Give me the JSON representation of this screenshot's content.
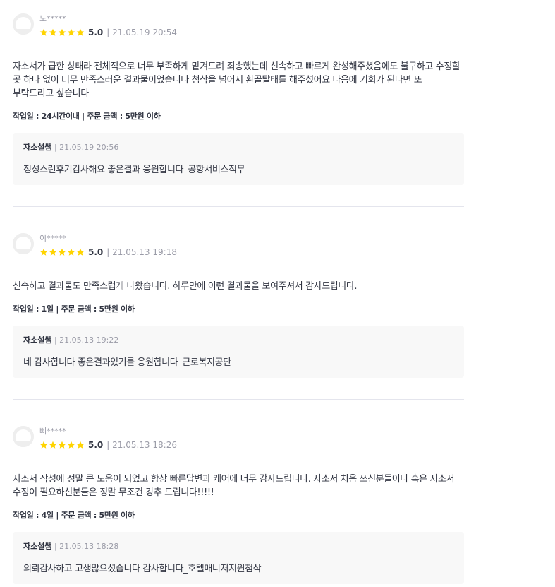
{
  "reviews": [
    {
      "nickname": "노*****",
      "score": "5.0",
      "date": "| 21.05.19 20:54",
      "content": "자소서가 급한 상태라 전체적으로 너무 부족하게 맡겨드려 죄송했는데 신속하고 빠르게 완성해주셨음에도 불구하고 수정할 곳 하나 없이 너무 만족스러운 결과물이었습니다 첨삭을 넘어서 환골탈태를 해주셨어요 다음에 기회가 된다면 또 부탁드리고 싶습니다",
      "meta": "작업일 : 24시간이내 | 주문 금액 : 5만원 이하",
      "reply": {
        "author": "자소설쌤",
        "date": " | 21.05.19 20:56",
        "text": "정성스런후기감사해요 좋은결과 응원합니다_공항서비스직무"
      }
    },
    {
      "nickname": "이*****",
      "score": "5.0",
      "date": "| 21.05.13 19:18",
      "content": "신속하고 결과물도 만족스럽게 나왔습니다. 하루만에 이런 결과물을 보여주셔서 감사드립니다.",
      "meta": "작업일 : 1일 | 주문 금액 : 5만원 이하",
      "reply": {
        "author": "자소설쌤",
        "date": " | 21.05.13 19:22",
        "text": "네 감사합니다 좋은결과있기를 응원합니다_근로복지공단"
      }
    },
    {
      "nickname": "삐*****",
      "score": "5.0",
      "date": "| 21.05.13 18:26",
      "content": "자소서 작성에 정말 큰 도움이 되었고 항상 빠른답변과 캐어에 너무 감사드립니다. 자소서 처음 쓰신분들이나 혹은 자소서 수정이 필요하신분들은 정말 무조건 강추 드립니다!!!!!",
      "meta": "작업일 : 4일 | 주문 금액 : 5만원 이하",
      "reply": {
        "author": "자소설쌤",
        "date": " | 21.05.13 18:28",
        "text": "의뢰감사하고 고생많으셨습니다 감사합니다_호텔매니저지원첨삭"
      }
    }
  ],
  "colors": {
    "star": "#ffd400",
    "divider": "#e4e5ed",
    "reply_bg": "#f8f8f8"
  },
  "icons": {
    "avatar": "default-profile-icon",
    "star": "star-icon"
  }
}
